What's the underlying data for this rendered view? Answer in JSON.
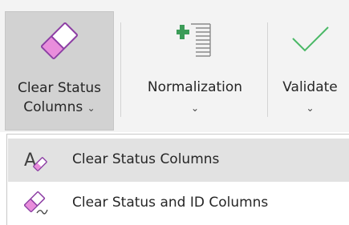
{
  "ribbon": {
    "buttons": [
      {
        "line1": "Clear Status",
        "line2": "Columns",
        "chevron": "⌄",
        "icon": "eraser-icon",
        "pressed": true
      },
      {
        "line1": "Normalization",
        "chevron": "⌄",
        "icon": "insert-row-icon"
      },
      {
        "line1": "Validate",
        "chevron": "⌄",
        "icon": "checkmark-icon"
      }
    ]
  },
  "menu": {
    "items": [
      {
        "label": "Clear Status Columns",
        "icon": "clear-format-icon",
        "highlighted": true
      },
      {
        "label": "Clear Status and ID Columns",
        "icon": "eraser-icon"
      }
    ]
  },
  "colors": {
    "eraser_pink": "#e98ddc",
    "eraser_purple": "#8d3ea4",
    "insert_green": "#3c9c58",
    "check_green": "#4ab866",
    "ribbon_bg": "#f3f3f3",
    "pressed_bg": "#d2d2d2",
    "menu_hover": "#e2e2e2"
  }
}
